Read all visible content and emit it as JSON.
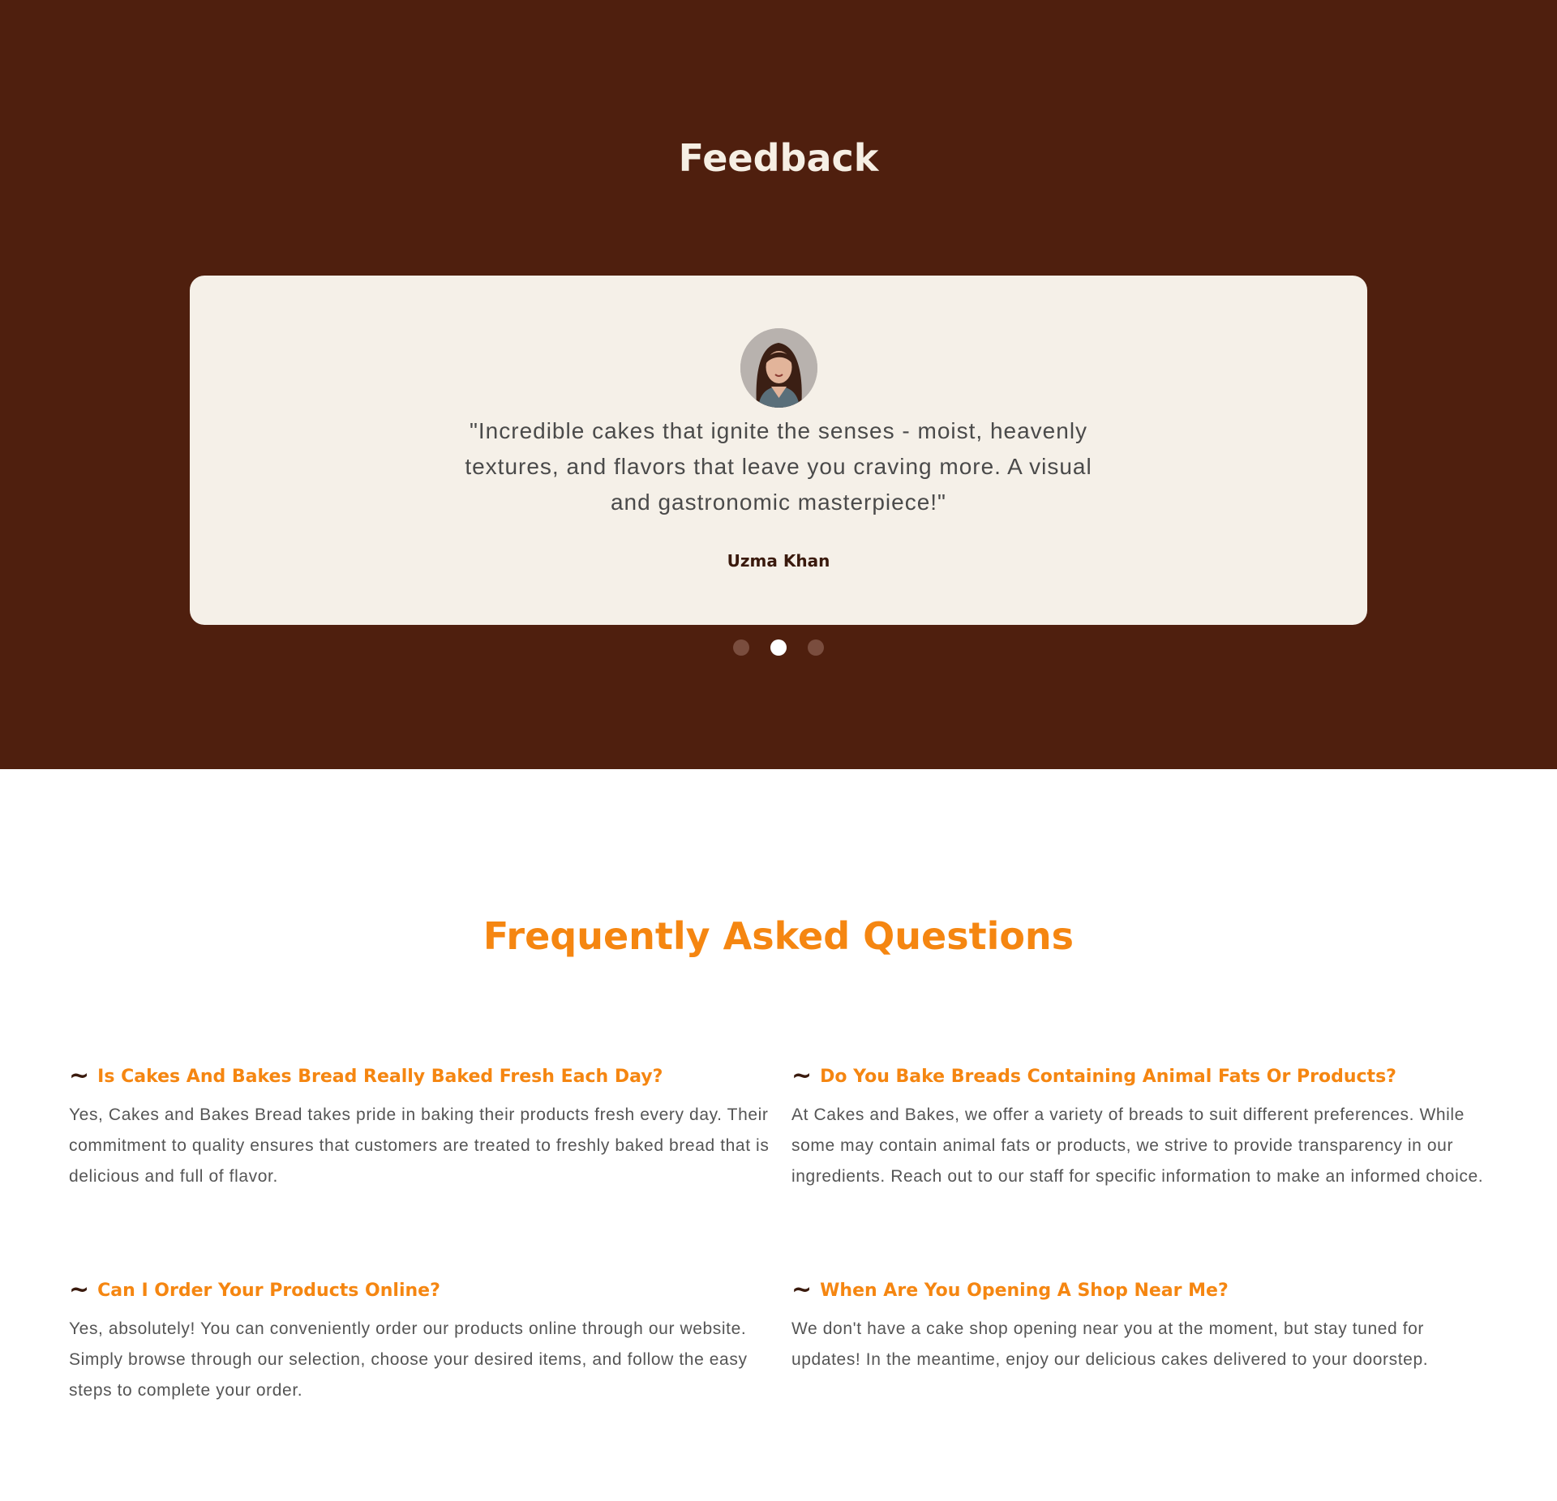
{
  "feedback": {
    "title": "Feedback",
    "testimonial": {
      "quote": "\"Incredible cakes that ignite the senses - moist, heavenly textures, and flavors that leave you craving more. A visual and gastronomic masterpiece!\"",
      "author": "Uzma Khan"
    },
    "carousel": {
      "slide_count": 3,
      "active_index": 1
    }
  },
  "faq": {
    "title": "Frequently Asked Questions",
    "items": [
      {
        "question": "Is Cakes And Bakes Bread Really Baked Fresh Each Day?",
        "answer": "Yes, Cakes and Bakes Bread takes pride in baking their products fresh every day. Their commitment to quality ensures that customers are treated to freshly baked bread that is delicious and full of flavor."
      },
      {
        "question": "Do You Bake Breads Containing Animal Fats Or Products?",
        "answer": "At Cakes and Bakes, we offer a variety of breads to suit different preferences. While some may contain animal fats or products, we strive to provide transparency in our ingredients. Reach out to our staff for specific information to make an informed choice."
      },
      {
        "question": "Can I Order Your Products Online?",
        "answer": "Yes, absolutely! You can conveniently order our products online through our website. Simply browse through our selection, choose your desired items, and follow the easy steps to complete your order."
      },
      {
        "question": "When Are You Opening A Shop Near Me?",
        "answer": "We don't have a cake shop opening near you at the moment, but stay tuned for updates! In the meantime, enjoy our delicious cakes delivered to your doorstep."
      }
    ],
    "bullet_glyph": "~"
  },
  "colors": {
    "feedback_bg": "#4f1f0e",
    "card_bg": "#f5f0e8",
    "accent_orange": "#f58611",
    "dark_brown": "#3a1a0d"
  }
}
